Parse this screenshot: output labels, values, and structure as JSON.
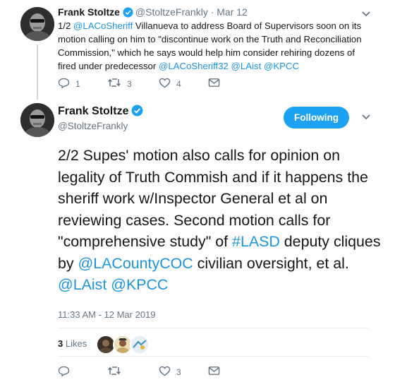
{
  "tweet1": {
    "name": "Frank Stoltze",
    "handle": "@StoltzeFrankly",
    "date": "· Mar 12",
    "text_prefix": "1/2 ",
    "mention1": "@LACoSheriff",
    "text_mid": " Villanueva to address Board of Supervisors soon on its motion calling on him to \"discontinue work on the Truth and Reconciliation Commission,\" which he says would help him consider rehiring dozens of fired under predecessor ",
    "mention2": "@LACoSheriff32",
    "mention3": "@LAist",
    "mention4": "@KPCC",
    "replies": "1",
    "retweets": "3",
    "likes": "4"
  },
  "tweet2": {
    "name": "Frank Stoltze",
    "handle": "@StoltzeFrankly",
    "follow_label": "Following",
    "text_part1": "2/2 Supes' motion also calls for opinion on legality of Truth Commish and if it happens the sheriff work w/Inspector General et al on reviewing cases. Second motion calls for \"comprehensive study\" of ",
    "hashtag": "#LASD",
    "text_part2": " deputy cliques by ",
    "mention1": "@LACountyCOC",
    "text_part3": " civilian oversight, et al. ",
    "mention2": "@LAist",
    "mention3": "@KPCC",
    "timestamp": "11:33 AM - 12 Mar 2019",
    "likes_count": "3",
    "likes_label": "Likes",
    "retweets": "",
    "likes": "3"
  },
  "colors": {
    "link": "#1b95e0",
    "button": "#1da1f2",
    "muted": "#657786"
  }
}
